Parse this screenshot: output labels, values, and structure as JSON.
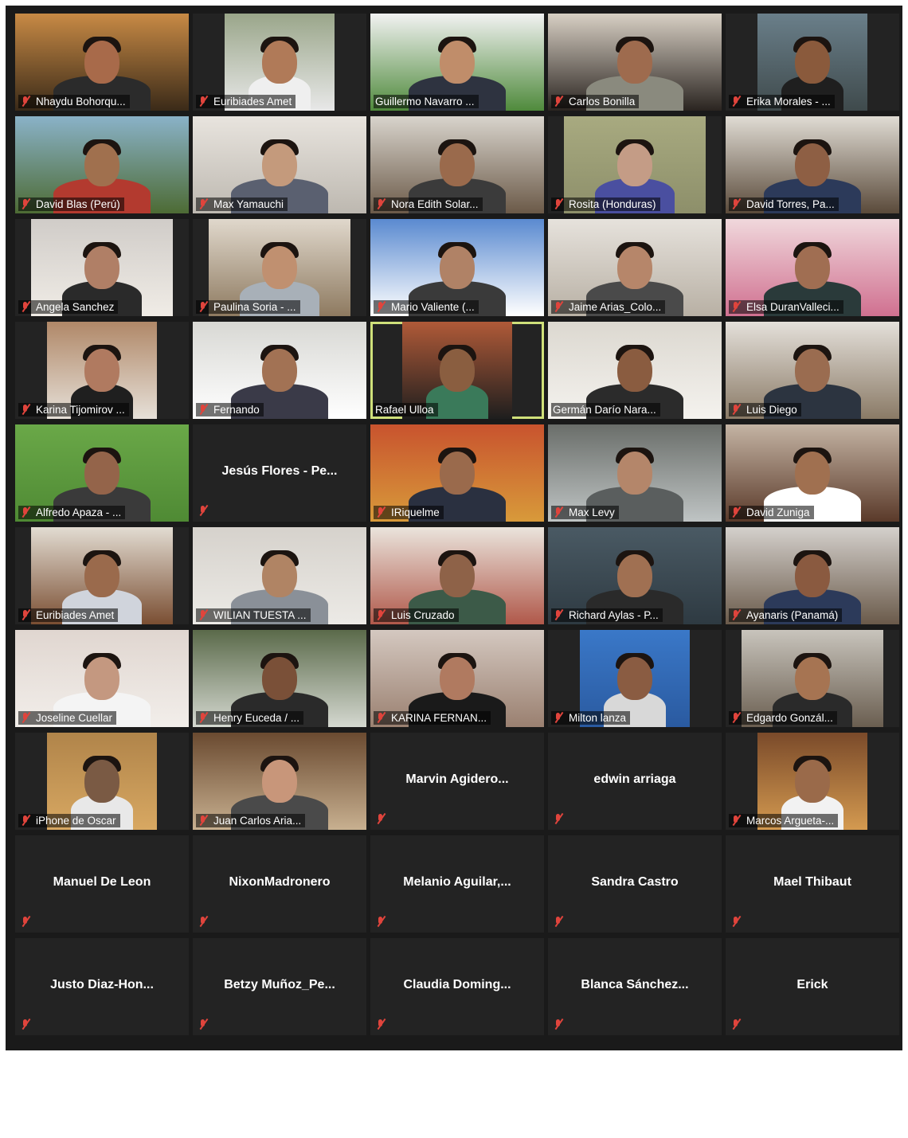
{
  "participants": [
    {
      "label": "Nhaydu Bohorqu...",
      "video": true,
      "muted": true,
      "bg": "#c88a45",
      "bg2": "#3a2a18",
      "skin": "#a86a4a",
      "shirt": "#2b2b2b",
      "vw": "full"
    },
    {
      "label": "Euribiades Amet",
      "video": true,
      "muted": true,
      "bg": "#9aa68a",
      "bg2": "#e8e8e8",
      "skin": "#b07a58",
      "shirt": "#efefef",
      "vw": "narrow"
    },
    {
      "label": "Guillermo Navarro ...",
      "video": true,
      "muted": false,
      "bg": "#f2f2f2",
      "bg2": "#4f8a3c",
      "skin": "#c08d6a",
      "shirt": "#2e3340",
      "vw": "full"
    },
    {
      "label": "Carlos Bonilla",
      "video": true,
      "muted": true,
      "bg": "#d8d0c4",
      "bg2": "#2a2420",
      "skin": "#9e6b4e",
      "shirt": "#8a8a7e",
      "vw": "full"
    },
    {
      "label": "Erika Morales - ...",
      "video": true,
      "muted": true,
      "bg": "#6a7f8a",
      "bg2": "#3f4a4c",
      "skin": "#8a5a3c",
      "shirt": "#1f1f1f",
      "vw": "narrow"
    },
    {
      "label": "David Blas (Perú)",
      "video": true,
      "muted": true,
      "bg": "#8ab2c8",
      "bg2": "#4d6b34",
      "skin": "#a0704e",
      "shirt": "#b33a2f",
      "vw": "full"
    },
    {
      "label": "Max Yamauchi",
      "video": true,
      "muted": true,
      "bg": "#e8e4de",
      "bg2": "#bdb8b0",
      "skin": "#c49a7c",
      "shirt": "#5a6070",
      "vw": "full"
    },
    {
      "label": "Nora Edith Solar...",
      "video": true,
      "muted": true,
      "bg": "#d8d4cc",
      "bg2": "#6b5a48",
      "skin": "#9a6a4c",
      "shirt": "#3b3b3b",
      "vw": "full"
    },
    {
      "label": "Rosita (Honduras)",
      "video": true,
      "muted": true,
      "bg": "#a8aa80",
      "bg2": "#8d8f6a",
      "skin": "#c49c86",
      "shirt": "#4a4fa0",
      "vw": "mid"
    },
    {
      "label": "David Torres, Pa...",
      "video": true,
      "muted": true,
      "bg": "#e0dcd4",
      "bg2": "#5a4a3a",
      "skin": "#8e5f44",
      "shirt": "#2c3a5a",
      "vw": "full"
    },
    {
      "label": "Angela Sanchez",
      "video": true,
      "muted": true,
      "bg": "#d0ccc8",
      "bg2": "#f0ece6",
      "skin": "#b07f66",
      "shirt": "#2a2a2a",
      "vw": "mid"
    },
    {
      "label": "Paulina Soria - ...",
      "video": true,
      "muted": true,
      "bg": "#e0d8cc",
      "bg2": "#8e7a60",
      "skin": "#c09070",
      "shirt": "#a8b0b8",
      "vw": "mid"
    },
    {
      "label": "Mario Valiente (...",
      "video": true,
      "muted": true,
      "bg": "#5a8ad0",
      "bg2": "#ffffff",
      "skin": "#b08266",
      "shirt": "#3a3a3a",
      "vw": "full"
    },
    {
      "label": "Jaime Arias_Colo...",
      "video": true,
      "muted": true,
      "bg": "#e6e2dc",
      "bg2": "#b8b0a4",
      "skin": "#b6866a",
      "shirt": "#4a4a4a",
      "vw": "full"
    },
    {
      "label": "Elsa DuranValleci...",
      "video": true,
      "muted": true,
      "bg": "#f0d8dc",
      "bg2": "#d07090",
      "skin": "#a06e52",
      "shirt": "#2a3a3a",
      "vw": "full"
    },
    {
      "label": "Karina Tijomirov ...",
      "video": true,
      "muted": true,
      "bg": "#b08868",
      "bg2": "#e6e0d8",
      "skin": "#b07a60",
      "shirt": "#1f1f1f",
      "vw": "narrow"
    },
    {
      "label": "Fernando",
      "video": true,
      "muted": true,
      "bg": "#d8d8d4",
      "bg2": "#ffffff",
      "skin": "#a27254",
      "shirt": "#3a3a48",
      "vw": "full"
    },
    {
      "label": "Rafael Ulloa",
      "video": true,
      "muted": false,
      "active": true,
      "bg": "#b05a38",
      "bg2": "#1e1e1e",
      "skin": "#8a5e40",
      "shirt": "#3a7a5a",
      "vw": "narrow"
    },
    {
      "label": "Germán Darío Nara...",
      "video": true,
      "muted": false,
      "bg": "#dcd8d0",
      "bg2": "#f4f2ee",
      "skin": "#8a5c40",
      "shirt": "#2b2b2b",
      "vw": "full"
    },
    {
      "label": "Luis Diego",
      "video": true,
      "muted": true,
      "bg": "#e4e0da",
      "bg2": "#8a7a66",
      "skin": "#9a6c50",
      "shirt": "#2c3440",
      "vw": "full"
    },
    {
      "label": "Alfredo Apaza - ...",
      "video": true,
      "muted": true,
      "bg": "#6aa848",
      "bg2": "#4f8a34",
      "skin": "#94644a",
      "shirt": "#3a3a3a",
      "vw": "full"
    },
    {
      "label": "Jesús Flores - Pe...",
      "video": false,
      "muted": true
    },
    {
      "label": "IRiquelme",
      "video": true,
      "muted": true,
      "bg": "#c8532e",
      "bg2": "#d89a3a",
      "skin": "#9a6a4c",
      "shirt": "#2a3040",
      "vw": "full"
    },
    {
      "label": "Max Levy",
      "video": true,
      "muted": true,
      "bg": "#6a6e6a",
      "bg2": "#bfc4c4",
      "skin": "#b4866a",
      "shirt": "#5a5e5e",
      "vw": "full"
    },
    {
      "label": "David Zuniga",
      "video": true,
      "muted": true,
      "bg": "#c4b4a4",
      "bg2": "#5a3a2a",
      "skin": "#a07050",
      "shirt": "#ffffff",
      "vw": "full"
    },
    {
      "label": "Euribiades Amet",
      "video": true,
      "muted": true,
      "bg": "#e2dcd2",
      "bg2": "#7a4e32",
      "skin": "#9a6a4c",
      "shirt": "#d0d4dc",
      "vw": "mid"
    },
    {
      "label": "WILIAN TUESTA ...",
      "video": true,
      "muted": true,
      "bg": "#d6d2cc",
      "bg2": "#eceae6",
      "skin": "#b08464",
      "shirt": "#8a9098",
      "vw": "full"
    },
    {
      "label": "Luis Cruzado",
      "video": true,
      "muted": true,
      "bg": "#eae4dc",
      "bg2": "#b0584a",
      "skin": "#8e6248",
      "shirt": "#3c5a48",
      "vw": "full"
    },
    {
      "label": "Richard Aylas - P...",
      "video": true,
      "muted": true,
      "bg": "#4a5a64",
      "bg2": "#2e3a42",
      "skin": "#a07052",
      "shirt": "#2a2a2a",
      "vw": "full"
    },
    {
      "label": "Ayanaris (Panamá)",
      "video": true,
      "muted": true,
      "bg": "#d4d0cc",
      "bg2": "#6a5a4a",
      "skin": "#8a5a40",
      "shirt": "#2c3a5a",
      "vw": "full"
    },
    {
      "label": "Joseline Cuellar",
      "video": true,
      "muted": true,
      "bg": "#e0d6d0",
      "bg2": "#f2eeea",
      "skin": "#c49880",
      "shirt": "#f4f4f4",
      "vw": "full"
    },
    {
      "label": "Henry Euceda / ...",
      "video": true,
      "muted": true,
      "bg": "#5a6a4a",
      "bg2": "#d4d8d0",
      "skin": "#7a5038",
      "shirt": "#2a2a2a",
      "vw": "full"
    },
    {
      "label": "KARINA FERNAN...",
      "video": true,
      "muted": true,
      "bg": "#d4c8c0",
      "bg2": "#9a8070",
      "skin": "#b07a60",
      "shirt": "#1a1a1a",
      "vw": "full"
    },
    {
      "label": "Milton lanza",
      "video": true,
      "muted": true,
      "bg": "#3a78c8",
      "bg2": "#2a5aa0",
      "skin": "#8a5c42",
      "shirt": "#d8d8d8",
      "vw": "narrow"
    },
    {
      "label": "Edgardo Gonzál...",
      "video": true,
      "muted": true,
      "bg": "#c8c4bc",
      "bg2": "#6a5e50",
      "skin": "#a67452",
      "shirt": "#2a2a2a",
      "vw": "mid"
    },
    {
      "label": "iPhone de Oscar",
      "video": true,
      "muted": true,
      "bg": "#b0844a",
      "bg2": "#d8a862",
      "skin": "#7a5a44",
      "shirt": "#e8e8e8",
      "vw": "narrow"
    },
    {
      "label": "Juan Carlos Aria...",
      "video": true,
      "muted": true,
      "bg": "#6a4a30",
      "bg2": "#c8b090",
      "skin": "#c8967a",
      "shirt": "#4a4a4a",
      "vw": "full"
    },
    {
      "label": "Marvin  Agidero...",
      "video": false,
      "muted": true
    },
    {
      "label": "edwin arriaga",
      "video": false,
      "muted": true
    },
    {
      "label": "Marcos Argueta-...",
      "video": true,
      "muted": true,
      "bg": "#7a4a2a",
      "bg2": "#d49a50",
      "skin": "#9a6a4a",
      "shirt": "#f2f2f2",
      "vw": "narrow"
    },
    {
      "label": "Manuel De Leon",
      "video": false,
      "muted": true
    },
    {
      "label": "NixonMadronero",
      "video": false,
      "muted": true
    },
    {
      "label": "Melanio  Aguilar,...",
      "video": false,
      "muted": true
    },
    {
      "label": "Sandra Castro",
      "video": false,
      "muted": true
    },
    {
      "label": "Mael Thibaut",
      "video": false,
      "muted": true
    },
    {
      "label": "Justo  Diaz-Hon...",
      "video": false,
      "muted": true
    },
    {
      "label": "Betzy  Muñoz_Pe...",
      "video": false,
      "muted": true
    },
    {
      "label": "Claudia  Doming...",
      "video": false,
      "muted": true
    },
    {
      "label": "Blanca  Sánchez...",
      "video": false,
      "muted": true
    },
    {
      "label": "Erick",
      "video": false,
      "muted": true
    }
  ]
}
